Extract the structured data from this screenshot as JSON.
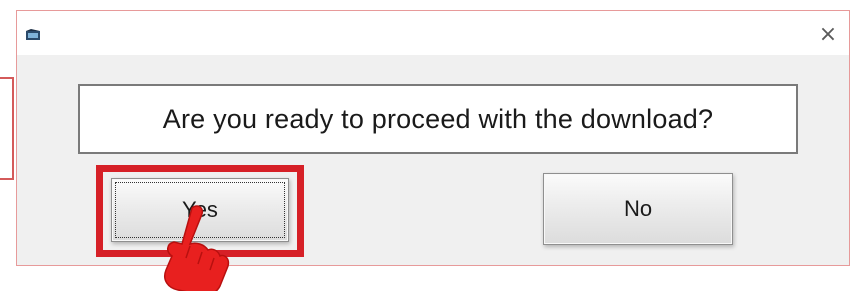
{
  "dialog": {
    "message": "Are you ready to proceed with the download?",
    "close_glyph": "×",
    "buttons": {
      "yes_label": "Yes",
      "no_label": "No"
    }
  },
  "icons": {
    "app": "app-icon",
    "close": "close-icon",
    "pointer": "hand-pointer-icon"
  },
  "colors": {
    "highlight": "#d62027",
    "pointer": "#e8201f",
    "dialog_background": "#f0f0f0"
  }
}
